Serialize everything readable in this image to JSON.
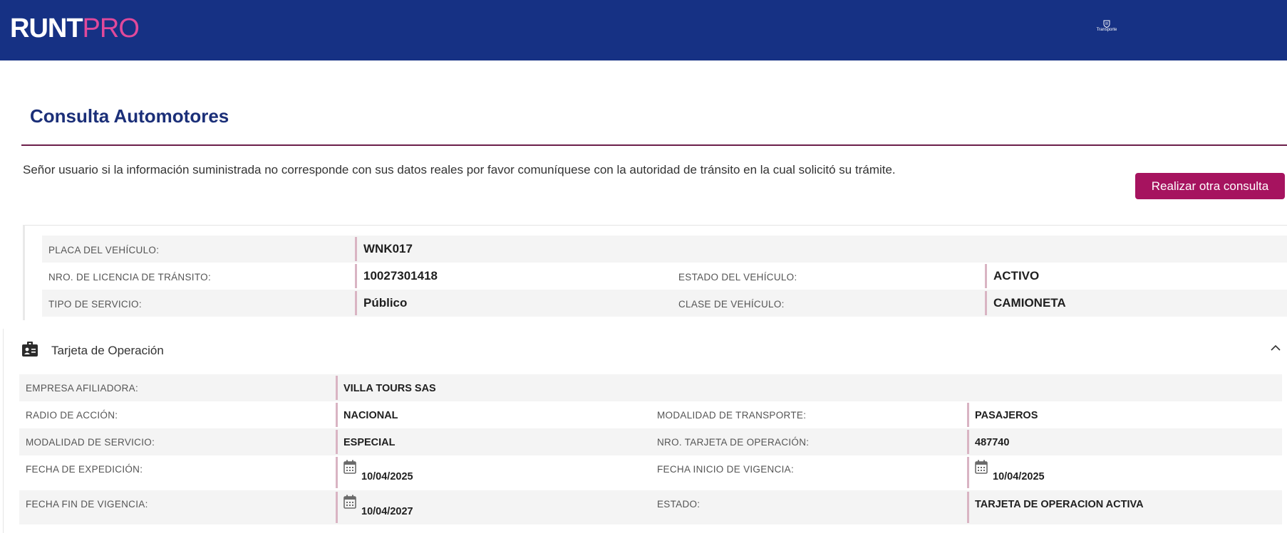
{
  "header": {
    "logo_part1": "RUNT",
    "logo_part2": "PRO",
    "partner_text": "Transporte",
    "colors": {
      "bar": "#163184",
      "logo_accent": "#e0499b"
    }
  },
  "page": {
    "title": "Consulta Automotores",
    "notice": "Señor usuario si la información suministrada no corresponde con sus datos reales por favor comuníquese con la autoridad de tránsito en la cual solicitó su trámite.",
    "new_query_button": "Realizar otra consulta",
    "accent_color": "#a6135f"
  },
  "vehicle": {
    "placa_label": "PLACA DEL VEHÍCULO:",
    "placa_value": "WNK017",
    "licencia_label": "NRO. DE LICENCIA DE TRÁNSITO:",
    "licencia_value": "10027301418",
    "estado_label": "ESTADO DEL VEHÍCULO:",
    "estado_value": "ACTIVO",
    "servicio_label": "TIPO DE SERVICIO:",
    "servicio_value": "Público",
    "clase_label": "CLASE DE VEHÍCULO:",
    "clase_value": "CAMIONETA"
  },
  "operation_card": {
    "title": "Tarjeta de Operación",
    "icons": {
      "header": "id-card-icon",
      "toggle": "chevron-up-icon",
      "date": "calendar-icon"
    },
    "empresa_label": "EMPRESA AFILIADORA:",
    "empresa_value": "VILLA TOURS SAS",
    "radio_label": "RADIO DE ACCIÓN:",
    "radio_value": "NACIONAL",
    "modalidad_transporte_label": "MODALIDAD DE TRANSPORTE:",
    "modalidad_transporte_value": "PASAJEROS",
    "modalidad_servicio_label": "MODALIDAD DE SERVICIO:",
    "modalidad_servicio_value": "ESPECIAL",
    "nro_tarjeta_label": "NRO. TARJETA DE OPERACIÓN:",
    "nro_tarjeta_value": "487740",
    "fecha_expedicion_label": "FECHA DE EXPEDICIÓN:",
    "fecha_expedicion_value": "10/04/2025",
    "fecha_inicio_label": "FECHA INICIO DE VIGENCIA:",
    "fecha_inicio_value": "10/04/2025",
    "fecha_fin_label": "FECHA FIN DE VIGENCIA:",
    "fecha_fin_value": "10/04/2027",
    "estado_label": "ESTADO:",
    "estado_value": "TARJETA DE OPERACION ACTIVA"
  }
}
